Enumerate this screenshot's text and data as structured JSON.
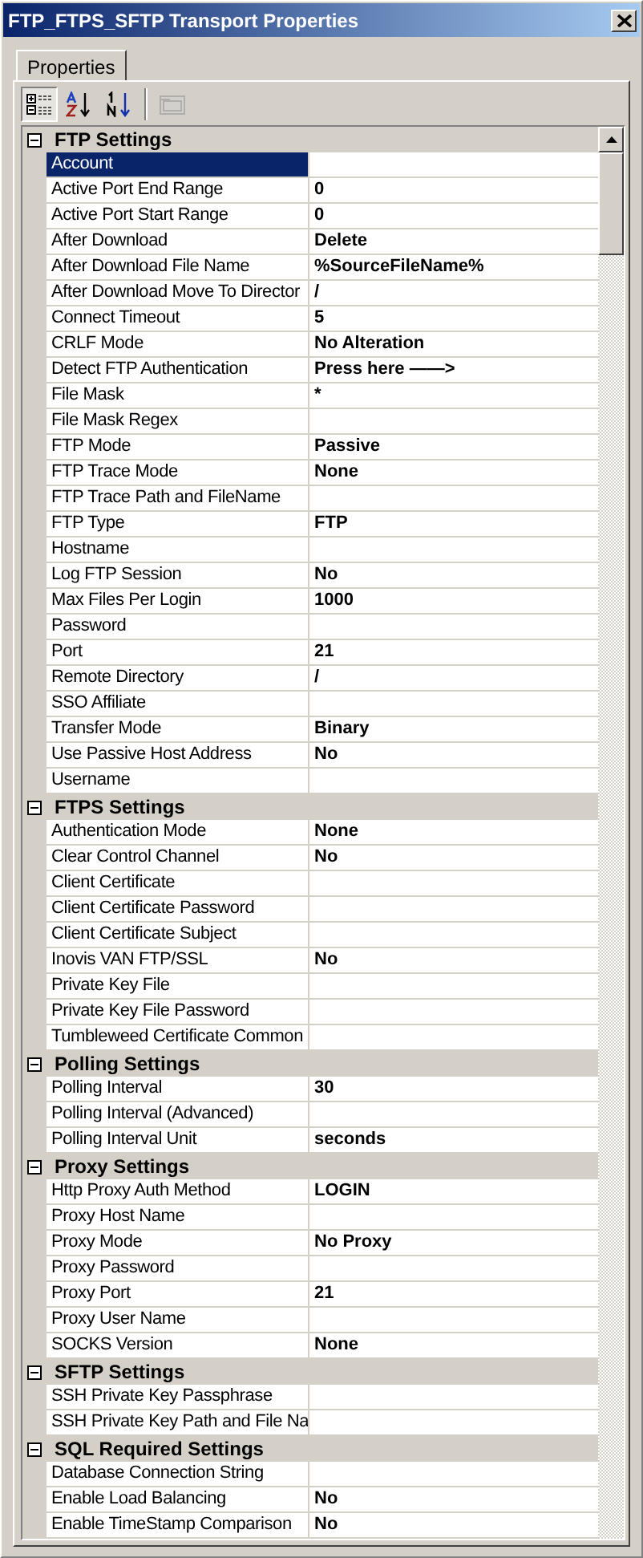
{
  "window": {
    "title": "FTP_FTPS_SFTP Transport Properties"
  },
  "tabs": [
    {
      "label": "Properties",
      "selected": true
    }
  ],
  "toolbar": [
    {
      "kind": "categorized",
      "pressed": true,
      "disabled": false
    },
    {
      "kind": "alphabetical",
      "pressed": false,
      "disabled": false
    },
    {
      "kind": "numeric",
      "pressed": false,
      "disabled": false
    },
    {
      "kind": "pages",
      "pressed": false,
      "disabled": true
    }
  ],
  "sections": [
    {
      "title": "FTP Settings",
      "expanded": true,
      "items": [
        {
          "name": "Account",
          "value": "",
          "selected": true
        },
        {
          "name": "Active Port End Range",
          "value": "0",
          "selected": false
        },
        {
          "name": "Active Port Start Range",
          "value": "0",
          "selected": false
        },
        {
          "name": "After Download",
          "value": "Delete",
          "selected": false
        },
        {
          "name": "After Download File Name",
          "value": "%SourceFileName%",
          "selected": false
        },
        {
          "name": "After Download Move To Director",
          "value": "/",
          "selected": false
        },
        {
          "name": "Connect Timeout",
          "value": "5",
          "selected": false
        },
        {
          "name": "CRLF Mode",
          "value": "No Alteration",
          "selected": false
        },
        {
          "name": "Detect FTP Authentication",
          "value": "Press here ——>",
          "selected": false
        },
        {
          "name": "File Mask",
          "value": "*",
          "selected": false
        },
        {
          "name": "File Mask Regex",
          "value": "",
          "selected": false
        },
        {
          "name": "FTP Mode",
          "value": "Passive",
          "selected": false
        },
        {
          "name": "FTP Trace Mode",
          "value": "None",
          "selected": false
        },
        {
          "name": "FTP Trace Path and FileName",
          "value": "",
          "selected": false
        },
        {
          "name": "FTP Type",
          "value": "FTP",
          "selected": false
        },
        {
          "name": "Hostname",
          "value": "",
          "selected": false
        },
        {
          "name": "Log FTP Session",
          "value": "No",
          "selected": false
        },
        {
          "name": "Max Files Per Login",
          "value": "1000",
          "selected": false
        },
        {
          "name": "Password",
          "value": "",
          "selected": false
        },
        {
          "name": "Port",
          "value": "21",
          "selected": false
        },
        {
          "name": "Remote Directory",
          "value": "/",
          "selected": false
        },
        {
          "name": "SSO Affiliate",
          "value": "",
          "selected": false
        },
        {
          "name": "Transfer Mode",
          "value": "Binary",
          "selected": false
        },
        {
          "name": "Use Passive Host Address",
          "value": "No",
          "selected": false
        },
        {
          "name": "Username",
          "value": "",
          "selected": false
        }
      ]
    },
    {
      "title": "FTPS Settings",
      "expanded": true,
      "items": [
        {
          "name": "Authentication Mode",
          "value": "None",
          "selected": false
        },
        {
          "name": "Clear Control Channel",
          "value": "No",
          "selected": false
        },
        {
          "name": "Client Certificate",
          "value": "",
          "selected": false
        },
        {
          "name": "Client Certificate Password",
          "value": "",
          "selected": false
        },
        {
          "name": "Client Certificate Subject",
          "value": "",
          "selected": false
        },
        {
          "name": "Inovis VAN FTP/SSL",
          "value": "No",
          "selected": false
        },
        {
          "name": "Private Key File",
          "value": "",
          "selected": false
        },
        {
          "name": "Private Key File Password",
          "value": "",
          "selected": false
        },
        {
          "name": "Tumbleweed Certificate Common",
          "value": "",
          "selected": false
        }
      ]
    },
    {
      "title": "Polling Settings",
      "expanded": true,
      "items": [
        {
          "name": "Polling Interval",
          "value": "30",
          "selected": false
        },
        {
          "name": "Polling Interval (Advanced)",
          "value": "",
          "selected": false
        },
        {
          "name": "Polling Interval Unit",
          "value": "seconds",
          "selected": false
        }
      ]
    },
    {
      "title": "Proxy Settings",
      "expanded": true,
      "items": [
        {
          "name": "Http Proxy Auth Method",
          "value": "LOGIN",
          "selected": false
        },
        {
          "name": "Proxy Host Name",
          "value": "",
          "selected": false
        },
        {
          "name": "Proxy Mode",
          "value": "No Proxy",
          "selected": false
        },
        {
          "name": "Proxy Password",
          "value": "",
          "selected": false
        },
        {
          "name": "Proxy Port",
          "value": "21",
          "selected": false
        },
        {
          "name": "Proxy User Name",
          "value": "",
          "selected": false
        },
        {
          "name": "SOCKS Version",
          "value": "None",
          "selected": false
        }
      ]
    },
    {
      "title": "SFTP Settings",
      "expanded": true,
      "items": [
        {
          "name": "SSH Private Key Passphrase",
          "value": "",
          "selected": false
        },
        {
          "name": "SSH Private Key Path and File Na",
          "value": "",
          "selected": false
        }
      ]
    },
    {
      "title": "SQL Required Settings",
      "expanded": true,
      "items": [
        {
          "name": "Database Connection String",
          "value": "",
          "selected": false
        },
        {
          "name": "Enable Load Balancing",
          "value": "No",
          "selected": false
        },
        {
          "name": "Enable TimeStamp Comparison",
          "value": "No",
          "selected": false
        }
      ]
    }
  ]
}
